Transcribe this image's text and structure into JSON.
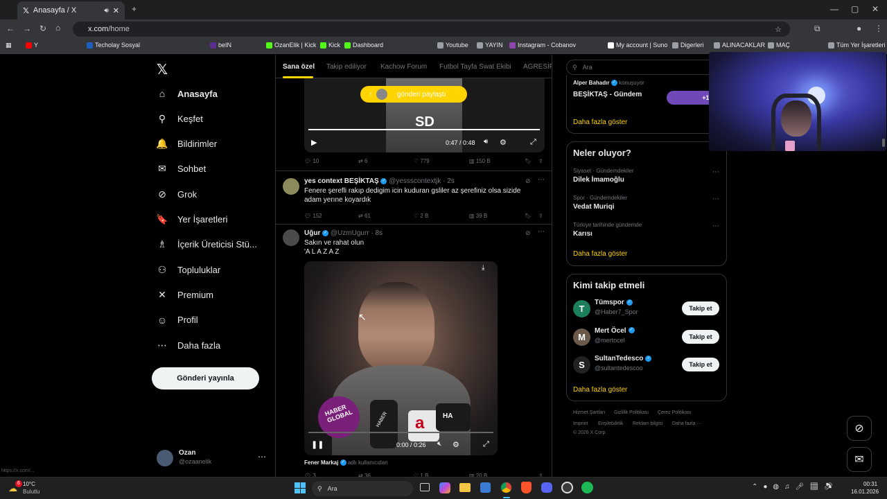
{
  "browser": {
    "tab_title": "Anasayfa / X",
    "url_host": "x.com",
    "url_path": "/home",
    "bookmarks": [
      {
        "label": "Y",
        "color": "#ff0000"
      },
      {
        "label": "Techolay Sosyal",
        "color": "#1d5fbf"
      },
      {
        "label": "beIN",
        "color": "#5b2d8e"
      },
      {
        "label": "OzanElik | Kick",
        "color": "#53fc18"
      },
      {
        "label": "Kick",
        "color": "#53fc18"
      },
      {
        "label": "Dashboard",
        "color": "#53fc18"
      },
      {
        "label": "Youtube",
        "color": "#9aa0a6"
      },
      {
        "label": "YAYIN",
        "color": "#9aa0a6"
      },
      {
        "label": "Instagram - Cobanov",
        "color": "#8e44ad"
      },
      {
        "label": "My account | Suno",
        "color": "#ffffff"
      },
      {
        "label": "Digerleri",
        "color": "#9aa0a6"
      },
      {
        "label": "ALINACAKLAR",
        "color": "#9aa0a6"
      },
      {
        "label": "MAÇ",
        "color": "#9aa0a6"
      }
    ],
    "all_bookmarks": "Tüm Yer İşaretleri"
  },
  "nav": {
    "items": [
      {
        "label": "Anasayfa",
        "icon": "home-icon",
        "glyph": "⌂",
        "active": true
      },
      {
        "label": "Keşfet",
        "icon": "search-icon",
        "glyph": "⚲"
      },
      {
        "label": "Bildirimler",
        "icon": "bell-icon",
        "glyph": "🔔"
      },
      {
        "label": "Sohbet",
        "icon": "mail-icon",
        "glyph": "✉"
      },
      {
        "label": "Grok",
        "icon": "grok-icon",
        "glyph": "⊘"
      },
      {
        "label": "Yer İşaretleri",
        "icon": "bookmark-icon",
        "glyph": "🔖"
      },
      {
        "label": "İçerik Üreticisi Stü...",
        "icon": "creator-icon",
        "glyph": "♗"
      },
      {
        "label": "Topluluklar",
        "icon": "communities-icon",
        "glyph": "⚇"
      },
      {
        "label": "Premium",
        "icon": "x-icon",
        "glyph": "✕"
      },
      {
        "label": "Profil",
        "icon": "profile-icon",
        "glyph": "☺"
      },
      {
        "label": "Daha fazla",
        "icon": "more-icon",
        "glyph": "⋯"
      }
    ],
    "post_button": "Gönderi yayınla",
    "user_name": "Ozan",
    "user_handle": "@ozaanelik"
  },
  "timeline": {
    "tabs": [
      "Sana özel",
      "Takip ediliyor",
      "Kachow Forum",
      "Futbol Tayfa Swat Ekibi",
      "AGRESİFL"
    ],
    "share_pill": "gönderi paylaştı",
    "video1": {
      "time": "0:47 / 0:48",
      "overlay": "SD"
    },
    "tweet1_actions": {
      "reply": "10",
      "retweet": "6",
      "like": "779",
      "views": "150 B"
    },
    "tweet2": {
      "name": "yes context BEŞİKTAŞ",
      "handle": "@yessscontextjk",
      "time": "2s",
      "text": "Fenere şerefli rakıp dedigim icin kuduran gsliler az şerefiniz olsa sizide adam yerıne koyardık",
      "actions": {
        "reply": "152",
        "retweet": "61",
        "like": "2 B",
        "views": "39 B"
      }
    },
    "tweet3": {
      "name": "Uğur",
      "handle": "@UzmUgurr",
      "time": "8s",
      "line1": "Sakın ve rahat olun",
      "line2": "'A L A Z A Z",
      "video_time": "0:00 / 0:26",
      "mic_labels": [
        "HABER GLOBAL",
        "HABER",
        "a",
        "HA"
      ],
      "quote_name": "Fener Markaj",
      "quote_sub": "adlı kullanıcıdan",
      "actions": {
        "reply": "3",
        "retweet": "36",
        "like": "1 B",
        "views": "20 B"
      }
    }
  },
  "sidebar": {
    "search_placeholder": "Ara",
    "top": {
      "name": "Alper Bahadır",
      "sub": "konuşuyor",
      "title": "BEŞİKTAŞ - Gündem",
      "count": "+1,"
    },
    "show_more": "Daha fazla göster",
    "trends_title": "Neler oluyor?",
    "trends": [
      {
        "context": "Siyaset · Gündemdekiler",
        "name": "Dilek İmamoğlu"
      },
      {
        "context": "Spor · Gündemdekiler",
        "name": "Vedat Muriqi"
      },
      {
        "context": "Türkiye tarihinde gündemde",
        "name": "Karısı"
      }
    ],
    "who_title": "Kimi takip etmeli",
    "who": [
      {
        "name": "Tümspor",
        "handle": "@Haber7_Spor",
        "avatar": "T",
        "color": "#1a7f5a"
      },
      {
        "name": "Mert Öcel",
        "handle": "@mertocel",
        "avatar": "M",
        "color": "#6b5a4a"
      },
      {
        "name": "SultanTedesco",
        "handle": "@sultantedescoo",
        "avatar": "S",
        "color": "#222222"
      }
    ],
    "follow_label": "Takip et",
    "footer": [
      "Hizmet Şartları",
      "Gizlilik Politikası",
      "Çerez Politikası",
      "Imprint",
      "Erişilebilirlik",
      "Reklam bilgisi",
      "Daha fazla ···",
      "© 2026 X Corp."
    ]
  },
  "taskbar": {
    "weather_temp": "10°C",
    "weather_desc": "Bulutlu",
    "search": "Ara",
    "time": "00:31",
    "date": "16.01.2026",
    "badge": "6"
  },
  "status_url": "https://x.com/..."
}
